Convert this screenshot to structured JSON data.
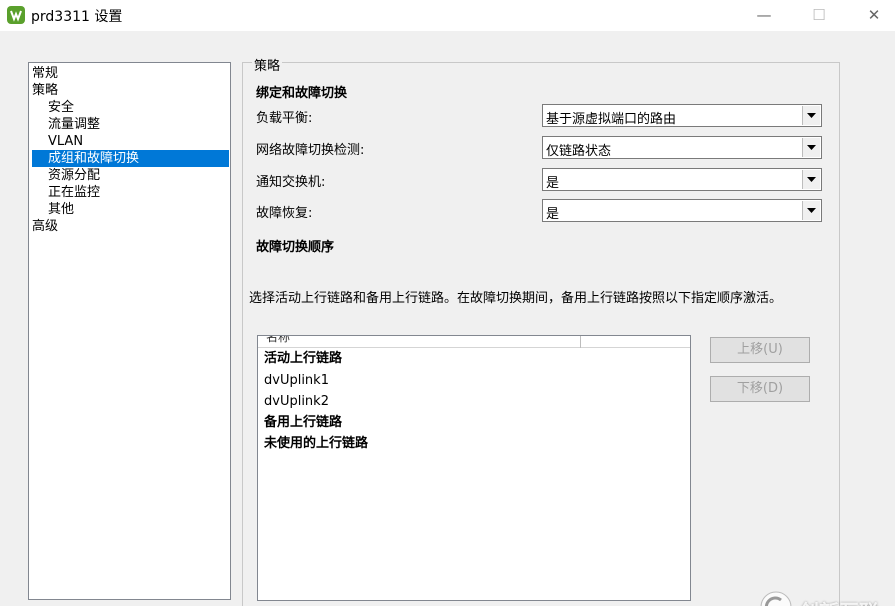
{
  "window": {
    "title": "prd3311 设置"
  },
  "tree": {
    "items": [
      {
        "label": "常规",
        "level": 0,
        "selected": false
      },
      {
        "label": "策略",
        "level": 0,
        "selected": false
      },
      {
        "label": "安全",
        "level": 1,
        "selected": false
      },
      {
        "label": "流量调整",
        "level": 1,
        "selected": false
      },
      {
        "label": "VLAN",
        "level": 1,
        "selected": false
      },
      {
        "label": "成组和故障切换",
        "level": 1,
        "selected": true
      },
      {
        "label": "资源分配",
        "level": 1,
        "selected": false
      },
      {
        "label": "正在监控",
        "level": 1,
        "selected": false
      },
      {
        "label": "其他",
        "level": 1,
        "selected": false
      },
      {
        "label": "高级",
        "level": 0,
        "selected": false
      }
    ]
  },
  "policy": {
    "group_title": "策略",
    "binding_heading": "绑定和故障切换",
    "fields": [
      {
        "label": "负载平衡:",
        "value": "基于源虚拟端口的路由"
      },
      {
        "label": "网络故障切换检测:",
        "value": "仅链路状态"
      },
      {
        "label": "通知交换机:",
        "value": "是"
      },
      {
        "label": "故障恢复:",
        "value": "是"
      }
    ],
    "order_heading": "故障切换顺序",
    "description": "选择活动上行链路和备用上行链路。在故障切换期间，备用上行链路按照以下指定顺序激活。",
    "list": {
      "column_header": "名称",
      "rows": [
        {
          "text": "活动上行链路",
          "group": true
        },
        {
          "text": "dvUplink1",
          "group": false
        },
        {
          "text": "dvUplink2",
          "group": false
        },
        {
          "text": "备用上行链路",
          "group": true
        },
        {
          "text": "未使用的上行链路",
          "group": true
        }
      ]
    },
    "buttons": {
      "move_up": "上移(U)",
      "move_down": "下移(D)"
    }
  },
  "watermark": {
    "text": "创新互联"
  },
  "colors": {
    "selection": "#0078d7",
    "app_icon": "#5aa02c"
  }
}
